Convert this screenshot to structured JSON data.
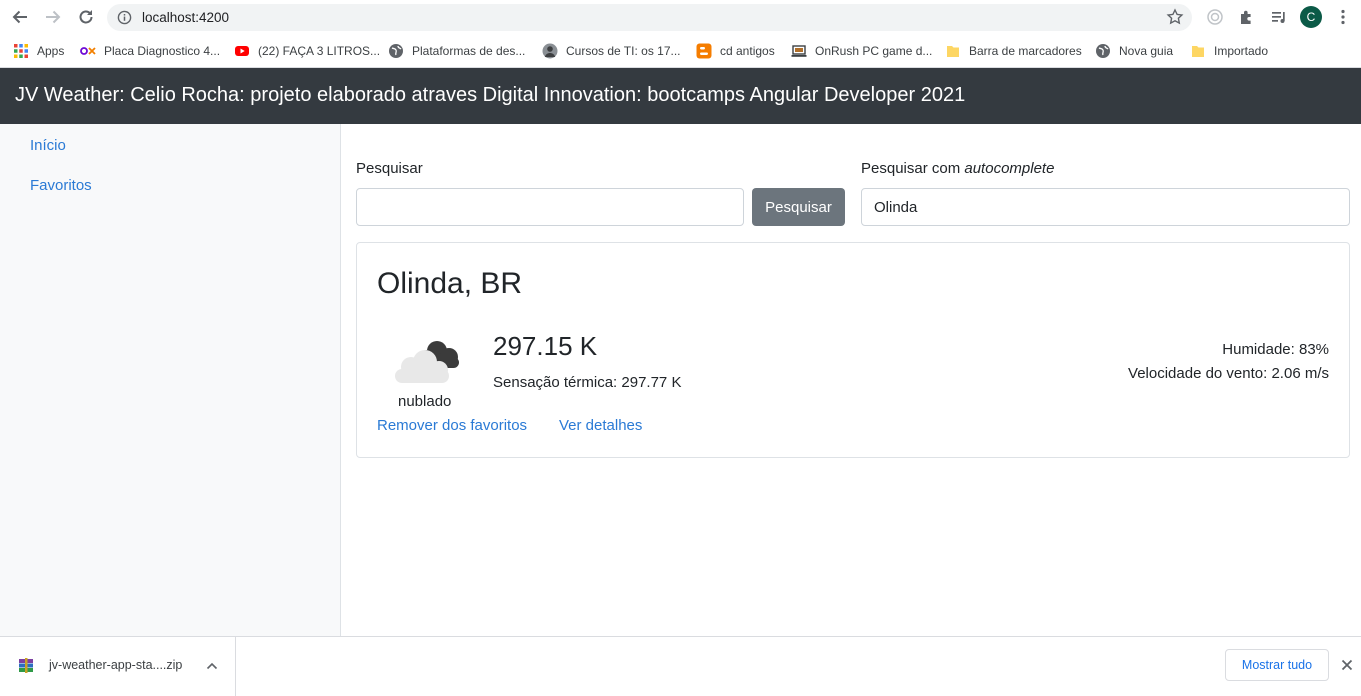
{
  "browser": {
    "url": "localhost:4200",
    "profile_initial": "C",
    "bookmarks": [
      {
        "label": "Apps",
        "icon": "apps-grid-icon"
      },
      {
        "label": "Placa Diagnostico 4...",
        "icon": "olx-icon"
      },
      {
        "label": "(22) FAÇA 3 LITROS...",
        "icon": "youtube-icon"
      },
      {
        "label": "Plataformas de des...",
        "icon": "globe-icon"
      },
      {
        "label": "Cursos de TI: os 17...",
        "icon": "avatar-icon"
      },
      {
        "label": "cd antigos",
        "icon": "blogger-icon"
      },
      {
        "label": "OnRush PC game d...",
        "icon": "laptop-icon"
      },
      {
        "label": "Barra de marcadores",
        "icon": "folder-icon"
      },
      {
        "label": "Nova guia",
        "icon": "globe-icon"
      },
      {
        "label": "Importado",
        "icon": "folder-icon"
      }
    ]
  },
  "app": {
    "title": "JV Weather: Celio Rocha: projeto elaborado atraves Digital Innovation: bootcamps Angular Developer 2021",
    "nav": [
      "Início",
      "Favoritos"
    ]
  },
  "search": {
    "label": "Pesquisar",
    "value": "",
    "button_label": "Pesquisar",
    "autocomplete_label_prefix": "Pesquisar com ",
    "autocomplete_label_em": "autocomplete",
    "autocomplete_value": "Olinda"
  },
  "weather": {
    "city": "Olinda, BR",
    "icon": "cloudy-icon",
    "description": "nublado",
    "temperature": "297.15 K",
    "feels_like": "Sensação térmica: 297.77 K",
    "humidity": "Humidade: 83%",
    "wind": "Velocidade do vento: 2.06 m/s",
    "remove_favorite_label": "Remover dos favoritos",
    "details_label": "Ver detalhes"
  },
  "downloads": {
    "file_name": "jv-weather-app-sta....zip",
    "show_all_label": "Mostrar tudo"
  },
  "colors": {
    "navbar": "#343a40",
    "link": "#2a7ad5",
    "button_secondary": "#6c757d",
    "sidebar_bg": "#f8f9fa"
  }
}
